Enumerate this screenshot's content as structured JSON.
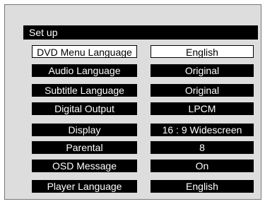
{
  "menu": {
    "title": "Set up",
    "rows": [
      {
        "label": "DVD Menu Language",
        "value": "English"
      },
      {
        "label": "Audio Language",
        "value": "Original"
      },
      {
        "label": "Subtitle Language",
        "value": "Original"
      },
      {
        "label": "Digital Output",
        "value": "LPCM"
      },
      {
        "label": "Display",
        "value": "16 : 9 Widescreen"
      },
      {
        "label": "Parental",
        "value": "8"
      },
      {
        "label": "OSD Message",
        "value": "On"
      },
      {
        "label": "Player Language",
        "value": "English"
      }
    ]
  },
  "colors": {
    "panel": "#dddddd",
    "bar": "#000000",
    "bar_text": "#ffffff",
    "selected_bg": "#ffffff",
    "selected_text": "#000000"
  }
}
